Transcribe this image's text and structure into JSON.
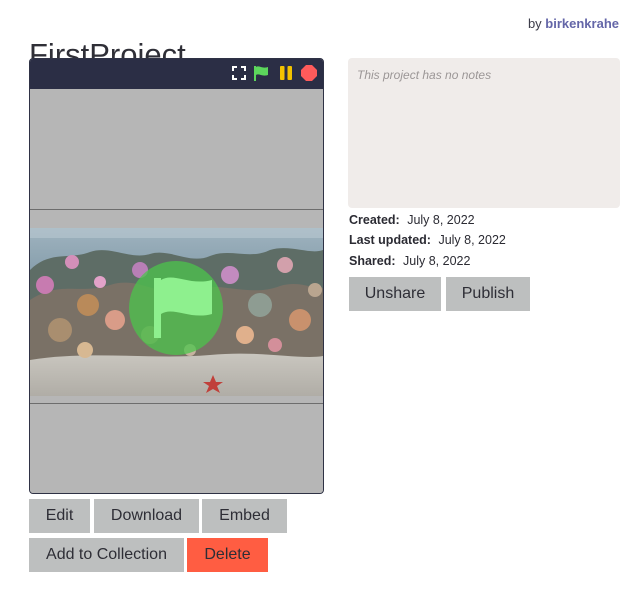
{
  "project": {
    "title": "FirstProject",
    "author_prefix": "by",
    "author_name": "birkenkrahe"
  },
  "player": {
    "toolbar_icons": [
      "fullscreen-icon",
      "green-flag-icon",
      "pause-icon",
      "stop-icon"
    ],
    "colors": {
      "toolbar": "#2b2e45",
      "flag": "#5cd65c",
      "pause": "#f2c200",
      "stop": "#ff5b5b"
    }
  },
  "actions": {
    "edit": "Edit",
    "download": "Download",
    "embed": "Embed",
    "add_to_collection": "Add to Collection",
    "delete": "Delete"
  },
  "notes": {
    "placeholder": "This project has no notes"
  },
  "meta": {
    "created_label": "Created:",
    "created_value": "July 8, 2022",
    "updated_label": "Last updated:",
    "updated_value": "July 8, 2022",
    "shared_label": "Shared:",
    "shared_value": "July 8, 2022"
  },
  "share_actions": {
    "unshare": "Unshare",
    "publish": "Publish"
  },
  "colors": {
    "button_gray": "#bdbfbf",
    "delete_red": "#ff5d42",
    "notes_bg": "#f0ecea",
    "author_link": "#6466a8"
  }
}
